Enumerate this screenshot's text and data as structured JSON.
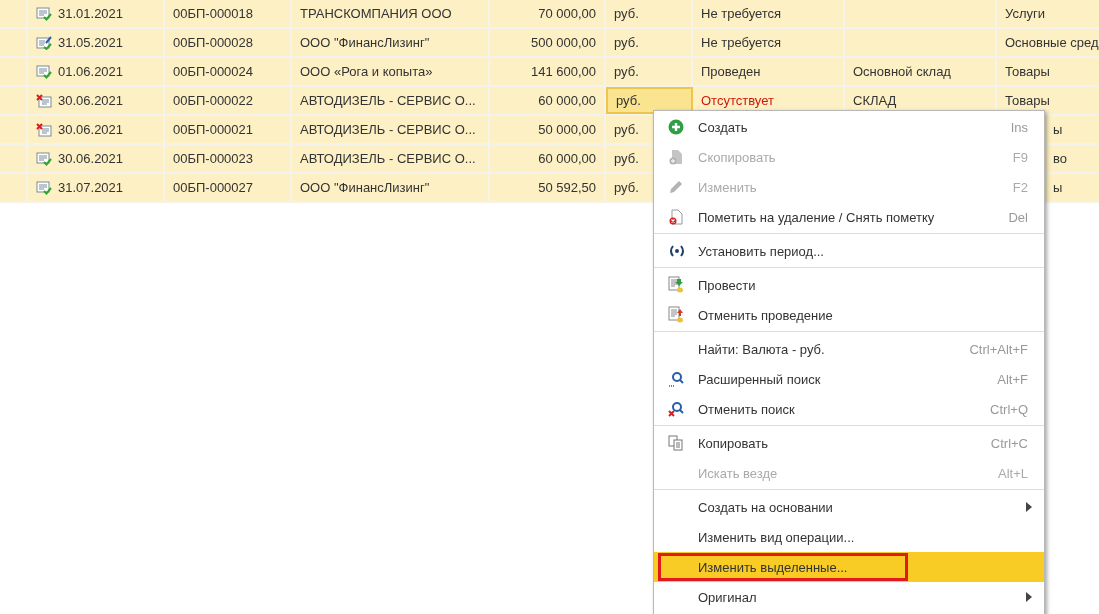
{
  "table": {
    "rows": [
      {
        "kind": "posted",
        "date": "31.01.2021",
        "number": "00БП-000018",
        "counterparty": "ТРАНСКОМПАНИЯ ООО",
        "amount": "70 000,00",
        "currency": "руб.",
        "state": "Не требуется",
        "warning": false,
        "type": "Услуги",
        "selected": false,
        "under_menu": false
      },
      {
        "kind": "posted_edited",
        "date": "31.05.2021",
        "number": "00БП-000028",
        "counterparty": "ООО \"ФинансЛизинг\"",
        "amount": "500 000,00",
        "currency": "руб.",
        "state": "Не требуется",
        "warning": false,
        "type": "Основные сред",
        "selected": false,
        "under_menu": false
      },
      {
        "kind": "posted",
        "date": "01.06.2021",
        "number": "00БП-000024",
        "counterparty": "ООО «Рога и копыта»",
        "amount": "141 600,00",
        "currency": "руб.",
        "state": "Проведен",
        "warning": false,
        "warehouse": "Основной склад",
        "type": "Товары",
        "selected": false,
        "under_menu": false
      },
      {
        "kind": "marked_deletion",
        "date": "30.06.2021",
        "number": "00БП-000022",
        "counterparty": "АВТОДИЗЕЛЬ - СЕРВИС О...",
        "amount": "60 000,00",
        "currency": "руб.",
        "state": "Отсутствует",
        "warning": true,
        "warehouse": "СКЛАД",
        "type": "Товары",
        "selected": true,
        "under_menu": false
      },
      {
        "kind": "marked_deletion",
        "date": "30.06.2021",
        "number": "00БП-000021",
        "counterparty": "АВТОДИЗЕЛЬ - СЕРВИС О...",
        "amount": "50 000,00",
        "currency": "руб.",
        "type": "ы",
        "selected": false,
        "under_menu": true
      },
      {
        "kind": "posted",
        "date": "30.06.2021",
        "number": "00БП-000023",
        "counterparty": "АВТОДИЗЕЛЬ - СЕРВИС О...",
        "amount": "60 000,00",
        "currency": "руб.",
        "type": "во",
        "selected": false,
        "under_menu": true
      },
      {
        "kind": "posted",
        "date": "31.07.2021",
        "number": "00БП-000027",
        "counterparty": "ООО \"ФинансЛизинг\"",
        "amount": "50 592,50",
        "currency": "руб.",
        "type": "ы",
        "selected": false,
        "under_menu": true
      }
    ]
  },
  "context_menu": {
    "items": [
      {
        "kind": "item",
        "label": "Создать",
        "shortcut": "Ins",
        "disabled": false,
        "selected": false
      },
      {
        "kind": "item",
        "label": "Скопировать",
        "shortcut": "F9",
        "disabled": true,
        "selected": false
      },
      {
        "kind": "item",
        "label": "Изменить",
        "shortcut": "F2",
        "disabled": true,
        "selected": false
      },
      {
        "kind": "item",
        "label": "Пометить на удаление / Снять пометку",
        "shortcut": "Del",
        "disabled": false,
        "selected": false
      },
      {
        "kind": "separator"
      },
      {
        "kind": "item",
        "label": "Установить период...",
        "disabled": false,
        "selected": false
      },
      {
        "kind": "separator"
      },
      {
        "kind": "item",
        "label": "Провести",
        "disabled": false,
        "selected": false
      },
      {
        "kind": "item",
        "label": "Отменить проведение",
        "disabled": false,
        "selected": false
      },
      {
        "kind": "separator"
      },
      {
        "kind": "item",
        "label": "Найти: Валюта - руб.",
        "shortcut": "Ctrl+Alt+F",
        "disabled": false,
        "selected": false
      },
      {
        "kind": "item",
        "label": "Расширенный поиск",
        "shortcut": "Alt+F",
        "disabled": false,
        "selected": false
      },
      {
        "kind": "item",
        "label": "Отменить поиск",
        "shortcut": "Ctrl+Q",
        "disabled": false,
        "selected": false
      },
      {
        "kind": "separator"
      },
      {
        "kind": "item",
        "label": "Копировать",
        "shortcut": "Ctrl+C",
        "disabled": false,
        "selected": false
      },
      {
        "kind": "item",
        "label": "Искать везде",
        "shortcut": "Alt+L",
        "disabled": true,
        "selected": false
      },
      {
        "kind": "separator"
      },
      {
        "kind": "item",
        "label": "Создать на основании",
        "submenu": true,
        "disabled": false,
        "selected": false
      },
      {
        "kind": "item",
        "label": "Изменить вид операции...",
        "disabled": false,
        "selected": false
      },
      {
        "kind": "item",
        "label": "Изменить выделенные...",
        "disabled": false,
        "selected": true,
        "annotated": true
      },
      {
        "kind": "item",
        "label": "Оригинал",
        "submenu": true,
        "disabled": false,
        "selected": false
      }
    ]
  }
}
